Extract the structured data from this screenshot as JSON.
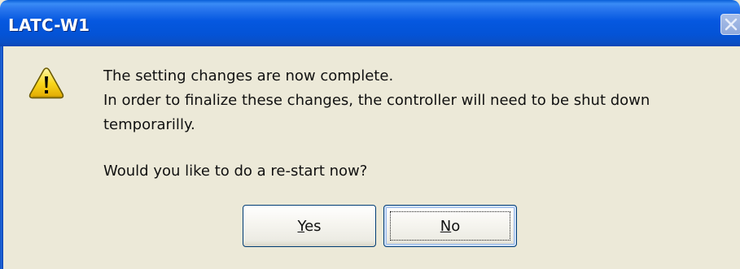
{
  "window": {
    "title": "LATC-W1"
  },
  "icons": {
    "dialog": "warning-icon",
    "close": "close-icon"
  },
  "message": {
    "lines": [
      "The setting changes are now complete.",
      "In order to finalize these changes, the controller will need to be shut down",
      "temporarilly."
    ],
    "question": "Would you like to do a re-start now?"
  },
  "buttons": {
    "yes": {
      "mnemonic": "Y",
      "rest": "es"
    },
    "no": {
      "mnemonic": "N",
      "rest": "o"
    }
  },
  "colors": {
    "titlebar": "#0558e0",
    "dialog_bg": "#ece9d8",
    "button_border": "#003c74",
    "warning_yellow": "#f9d71c"
  }
}
